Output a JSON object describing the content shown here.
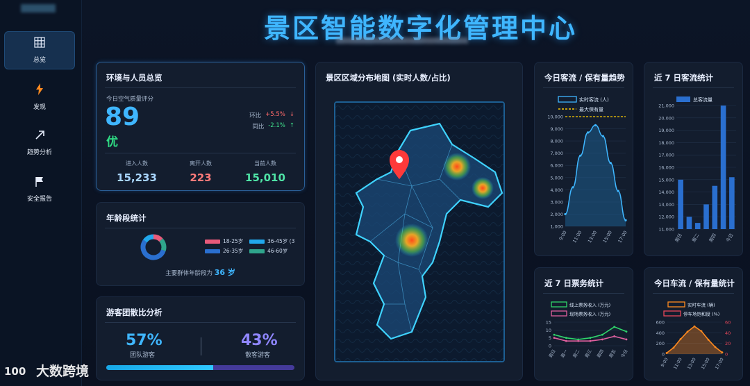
{
  "header": {
    "title": "景区智能数字化管理中心"
  },
  "sidebar": {
    "items": [
      {
        "label": "总览",
        "icon": "grid-icon"
      },
      {
        "label": "发现",
        "icon": "lightning-icon"
      },
      {
        "label": "趋势分析",
        "icon": "trend-arrow-icon"
      },
      {
        "label": "安全报告",
        "icon": "flag-icon"
      }
    ]
  },
  "env": {
    "title": "环境与人员总览",
    "aqi_label": "今日空气质量评分",
    "aqi_value": "89",
    "aqi_grade": "优",
    "hb_label": "环比",
    "hb_value": "+5.5%",
    "tb_label": "同比",
    "tb_value": "-2.1%",
    "stats": [
      {
        "label": "进入人数",
        "value": "15,233",
        "color": "#a9d6ff"
      },
      {
        "label": "离开人数",
        "value": "223",
        "color": "#ff7a7a"
      },
      {
        "label": "当前人数",
        "value": "15,010",
        "color": "#4fe3a6"
      }
    ]
  },
  "age": {
    "title": "年龄段统计",
    "legend": [
      {
        "label": "18-25岁",
        "color": "#e85a7a"
      },
      {
        "label": "36-45岁 (3",
        "color": "#21a8ec"
      },
      {
        "label": "26-35岁",
        "color": "#2a6fcf"
      },
      {
        "label": "46-60岁",
        "color": "#2fa58c"
      }
    ],
    "note_prefix": "主要群体年龄段为",
    "note_value": "36 岁",
    "slices": [
      0.13,
      0.17,
      0.55,
      0.15
    ]
  },
  "group": {
    "title": "游客团散比分析",
    "team_value": "57%",
    "team_label": "团队游客",
    "scatter_value": "43%",
    "scatter_label": "散客游客",
    "team_fraction": 0.57
  },
  "map": {
    "title": "景区区域分布地图 (实时人数/占比)"
  },
  "flow": {
    "title": "今日客流 / 保有量趋势",
    "legend_line": "实时客流 (人)",
    "legend_dash": "最大保有量",
    "chart_data": {
      "type": "area",
      "x": [
        "9:00",
        "10:00",
        "11:00",
        "12:00",
        "13:00",
        "14:00",
        "15:00",
        "16:00",
        "17:00"
      ],
      "values": [
        2000,
        4200,
        6800,
        8700,
        9300,
        8400,
        6200,
        3900,
        1500
      ],
      "max_capacity": 10000,
      "ylim": [
        1000,
        10000
      ],
      "yticks": [
        "1,000",
        "2,000",
        "3,000",
        "4,000",
        "5,000",
        "6,000",
        "7,000",
        "8,000",
        "9,000",
        "10,000"
      ],
      "xticks": [
        "9:00",
        "11:00",
        "13:00",
        "15:00",
        "17:00"
      ]
    }
  },
  "week": {
    "title": "近 7 日客流统计",
    "legend": "总客流量",
    "chart_data": {
      "type": "bar",
      "categories": [
        "周日",
        "周一",
        "周二",
        "周三",
        "周四",
        "周五",
        "今日"
      ],
      "values": [
        15000,
        12000,
        11500,
        13000,
        14500,
        21000,
        15200
      ],
      "ylim": [
        11000,
        21000
      ],
      "yticks": [
        "11,000",
        "12,000",
        "13,000",
        "14,000",
        "15,000",
        "16,000",
        "17,000",
        "18,000",
        "19,000",
        "20,000",
        "21,000"
      ],
      "xticks": [
        "周日",
        "周二",
        "周四",
        "今日"
      ]
    }
  },
  "ticket": {
    "title": "近 7 日票务统计",
    "legend_online": "线上票务收入 (万元)",
    "legend_offline": "现场票务收入 (万元)",
    "chart_data": {
      "type": "line",
      "categories": [
        "周日",
        "周一",
        "周二",
        "周三",
        "周四",
        "周五",
        "今日"
      ],
      "series": [
        {
          "name": "线上票务收入 (万元)",
          "values": [
            7,
            5,
            4,
            5,
            7,
            12,
            9
          ],
          "color": "#2fd46a"
        },
        {
          "name": "现场票务收入 (万元)",
          "values": [
            5,
            3,
            3,
            3,
            4,
            6,
            4
          ],
          "color": "#e05f9e"
        }
      ],
      "ylim": [
        0,
        15
      ],
      "yticks": [
        "0",
        "5",
        "10",
        "15"
      ]
    }
  },
  "car": {
    "title": "今日车流 / 保有量统计",
    "legend_flow": "实时车流 (辆)",
    "legend_rate": "停车场饱和度 (%)",
    "chart_data": {
      "type": "area",
      "x": [
        "9:00",
        "10:00",
        "11:00",
        "12:00",
        "13:00",
        "14:00",
        "15:00",
        "16:00",
        "17:00"
      ],
      "values": [
        20,
        120,
        280,
        420,
        520,
        430,
        270,
        130,
        30
      ],
      "ylim": [
        0,
        600
      ],
      "yticks_left": [
        "0",
        "200",
        "400",
        "600"
      ],
      "yticks_right": [
        "0",
        "20",
        "40",
        "60"
      ],
      "xticks": [
        "9:00",
        "11:00",
        "13:00",
        "15:00",
        "17:00"
      ]
    }
  },
  "watermark": {
    "text": "大数跨境"
  }
}
